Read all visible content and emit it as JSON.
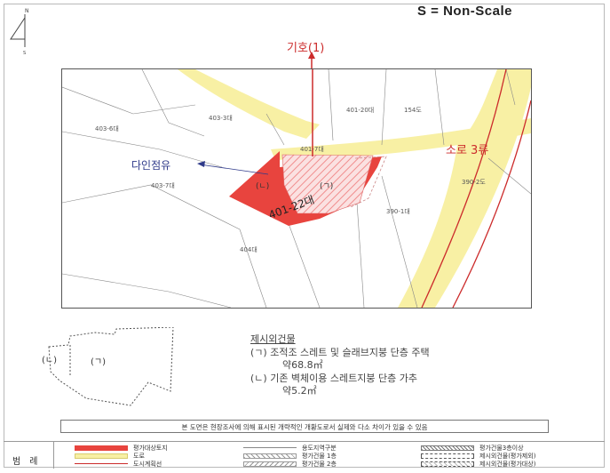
{
  "header": {
    "scale_text": "S = Non-Scale"
  },
  "north_arrow": {
    "top_letter": "N",
    "bottom_letter": "S"
  },
  "map": {
    "callout_top": "기호(1)",
    "callout_road": "소로 3류",
    "callout_shared": "다인점유",
    "parcel_label": "401-22대",
    "parcels": [
      "403-3대",
      "403-6대",
      "403-7대",
      "401-20대",
      "154도",
      "390-2도",
      "390-1대",
      "404대",
      "401-7대"
    ],
    "building_labels": [
      "(ㄴ)",
      "(ㄱ)"
    ]
  },
  "sketch": {
    "labels": [
      "(ㄴ)",
      "(ㄱ)"
    ]
  },
  "notes": {
    "title": "제시외건물",
    "lines": [
      "(ㄱ) 조적조 스레트 및 슬래브지붕 단층 주택",
      "약68.8㎡",
      "(ㄴ) 기존 벽체이용 스레트지붕 단층 가추",
      "약5.2㎡"
    ]
  },
  "notice": "본 도면은 현장조사에 의해 표시된 개략적인 개황도로서 실제와 다소 차이가 있을 수 있음",
  "legend": {
    "title": "범례",
    "items": [
      {
        "label": "평가대상토지"
      },
      {
        "label": "도로"
      },
      {
        "label": "도시계획선"
      },
      {
        "label": "용도지역구분"
      },
      {
        "label": "평가건물 1층"
      },
      {
        "label": "평가건물 2층"
      },
      {
        "label": "평가건물3층이상"
      },
      {
        "label": "제시외건물(평가제외)"
      },
      {
        "label": "제시외건물(평가대상)"
      }
    ]
  },
  "colors": {
    "target_red": "#e8443e",
    "road_yellow": "#f8f0a4",
    "plan_line": "#cc2b2b",
    "hatch_pink": "#f4a7a7",
    "arrow_blue": "#2f3a8a"
  }
}
